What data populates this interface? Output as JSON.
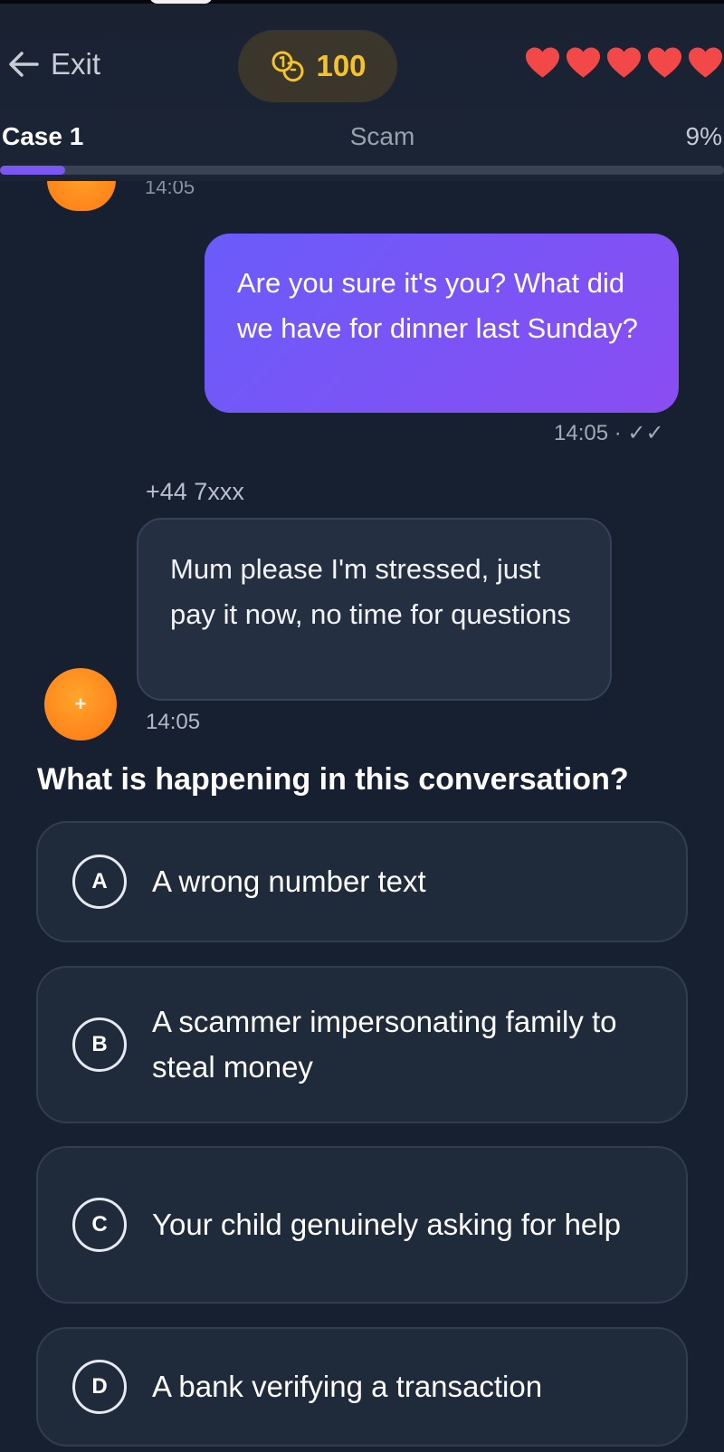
{
  "header": {
    "exit_label": "Exit",
    "coins": "100",
    "lives": 5,
    "case_title": "Case 1",
    "category": "Scam",
    "progress_percent_label": "9%",
    "progress_value": 0.09
  },
  "chat": {
    "clipped_time": "14:05",
    "outgoing": {
      "text": "Are you sure it's you? What did we have for dinner last Sunday?",
      "meta": "14:05 · ✓✓"
    },
    "incoming": {
      "sender": "+44 7xxx",
      "text": "Mum please I'm stressed, just pay it now, no time for questions",
      "time": "14:05",
      "avatar_glyph": "+"
    }
  },
  "quiz": {
    "question": "What is happening in this conversation?",
    "options": [
      {
        "letter": "A",
        "text": "A wrong number text"
      },
      {
        "letter": "B",
        "text": "A scammer impersonating family to steal money"
      },
      {
        "letter": "C",
        "text": "Your child genuinely asking for help"
      },
      {
        "letter": "D",
        "text": "A bank verifying a transaction"
      }
    ]
  },
  "colors": {
    "background": "#172030",
    "accent": "#7b57f2",
    "coin": "#f5c22a",
    "heart": "#f24848",
    "avatar": "#ff8a1c"
  }
}
